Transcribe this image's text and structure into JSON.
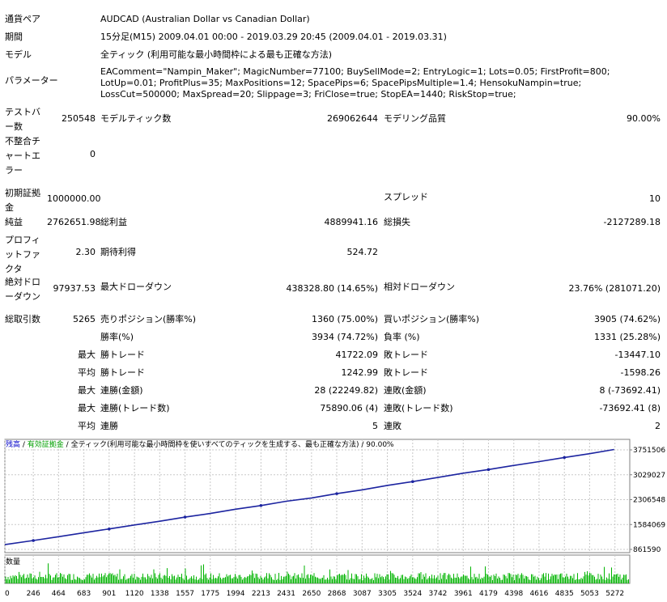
{
  "report": {
    "symbol_label": "通貨ペア",
    "symbol_value": "AUDCAD (Australian Dollar vs Canadian Dollar)",
    "period_label": "期間",
    "period_value": "15分足(M15) 2009.04.01 00:00 - 2019.03.29 20:45 (2009.04.01 - 2019.03.31)",
    "model_label": "モデル",
    "model_value": "全ティック (利用可能な最小時間枠による最も正確な方法)",
    "params_label": "パラメーター",
    "params_value": "EAComment=\"Nampin_Maker\"; MagicNumber=77100; BuySellMode=2; EntryLogic=1; Lots=0.05; FirstProfit=800; LotUp=0.01; ProfitPlus=35; MaxPositions=12; SpacePips=6; SpacePipsMultiple=1.4; HensokuNampin=true; LossCut=500000; MaxSpread=20; Slippage=3; FriClose=true; StopEA=1440; RiskStop=true;",
    "bars_label": "テストバー数",
    "bars_value": "250548",
    "ticks_label": "モデルティック数",
    "ticks_value": "269062644",
    "quality_label": "モデリング品質",
    "quality_value": "90.00%",
    "mismatch_label": "不整合チャートエラー",
    "mismatch_value": "0",
    "deposit_label": "初期証拠金",
    "deposit_value": "1000000.00",
    "spread_label": "スプレッド",
    "spread_value": "10",
    "net_label": "純益",
    "net_value": "2762651.98",
    "gross_profit_label": "総利益",
    "gross_profit_value": "4889941.16",
    "gross_loss_label": "総損失",
    "gross_loss_value": "-2127289.18",
    "pf_label": "プロフィットファクタ",
    "pf_value": "2.30",
    "expected_label": "期待利得",
    "expected_value": "524.72",
    "abs_dd_label": "絶対ドローダウン",
    "abs_dd_value": "97937.53",
    "max_dd_label": "最大ドローダウン",
    "max_dd_value": "438328.80 (14.65%)",
    "rel_dd_label": "相対ドローダウン",
    "rel_dd_value": "23.76% (281071.20)",
    "trades_label": "総取引数",
    "trades_value": "5265",
    "short_label": "売りポジション(勝率%)",
    "short_value": "1360 (75.00%)",
    "long_label": "買いポジション(勝率%)",
    "long_value": "3905 (74.62%)",
    "winrate_label": "勝率(%)",
    "winrate_value": "3934 (74.72%)",
    "lossrate_label": "負率 (%)",
    "lossrate_value": "1331 (25.28%)",
    "max_word": "最大",
    "avg_word": "平均",
    "largest_win_label": "勝トレード",
    "largest_win_value": "41722.09",
    "largest_loss_label": "敗トレード",
    "largest_loss_value": "-13447.10",
    "avg_win_label": "勝トレード",
    "avg_win_value": "1242.99",
    "avg_loss_label": "敗トレード",
    "avg_loss_value": "-1598.26",
    "cons_wins_label": "連勝(金額)",
    "cons_wins_value": "28 (22249.82)",
    "cons_losses_label": "連敗(金額)",
    "cons_losses_value": "8 (-73692.41)",
    "cons_profit_label": "連勝(トレード数)",
    "cons_profit_value": "75890.06 (4)",
    "cons_loss_label": "連敗(トレード数)",
    "cons_loss_value": "-73692.41 (8)",
    "avg_cons_wins_label": "連勝",
    "avg_cons_wins_value": "5",
    "avg_cons_losses_label": "連敗",
    "avg_cons_losses_value": "2"
  },
  "chart": {
    "legend_balance": "残高",
    "legend_sep1": " / ",
    "legend_equity": "有効証拠金",
    "legend_sep2": " / ",
    "legend_desc": "全ティック(利用可能な最小時間枠を使いすべてのティックを生成する、最も正確な方法)",
    "legend_quality": " / 90.00%",
    "volume_label": "数量",
    "colors": {
      "balance": "#1c24a0",
      "equity": "#00a000",
      "volume": "#00b400",
      "grid": "#c8c8c8",
      "legend_balance": "#0000c8",
      "legend_equity": "#00a000"
    }
  },
  "chart_data": {
    "type": "line",
    "xlabel": "",
    "ylabel": "",
    "x_ticks": [
      "0",
      "246",
      "464",
      "683",
      "901",
      "1120",
      "1338",
      "1557",
      "1775",
      "1994",
      "2213",
      "2431",
      "2650",
      "2868",
      "3087",
      "3305",
      "3524",
      "3742",
      "3961",
      "4179",
      "4398",
      "4616",
      "4835",
      "5053",
      "5272"
    ],
    "y_ticks": [
      "3751506",
      "3029027",
      "2306548",
      "1584069",
      "861590"
    ],
    "ylim": [
      861590,
      3751506
    ],
    "xlim": [
      0,
      5400
    ],
    "grid": true,
    "series": [
      {
        "name": "残高",
        "x": [
          0,
          246,
          464,
          683,
          901,
          1120,
          1338,
          1557,
          1775,
          1994,
          2213,
          2431,
          2650,
          2868,
          3087,
          3305,
          3524,
          3742,
          3961,
          4179,
          4398,
          4616,
          4835,
          5053,
          5265
        ],
        "y": [
          1000000,
          1120000,
          1230000,
          1345000,
          1455000,
          1570000,
          1680000,
          1800000,
          1905000,
          2030000,
          2135000,
          2260000,
          2355000,
          2480000,
          2590000,
          2720000,
          2830000,
          2950000,
          3075000,
          3180000,
          3300000,
          3410000,
          3530000,
          3640000,
          3762652
        ]
      }
    ],
    "volume_series": {
      "name": "数量",
      "x": [
        0,
        5265
      ],
      "y": [
        1,
        1
      ]
    }
  }
}
